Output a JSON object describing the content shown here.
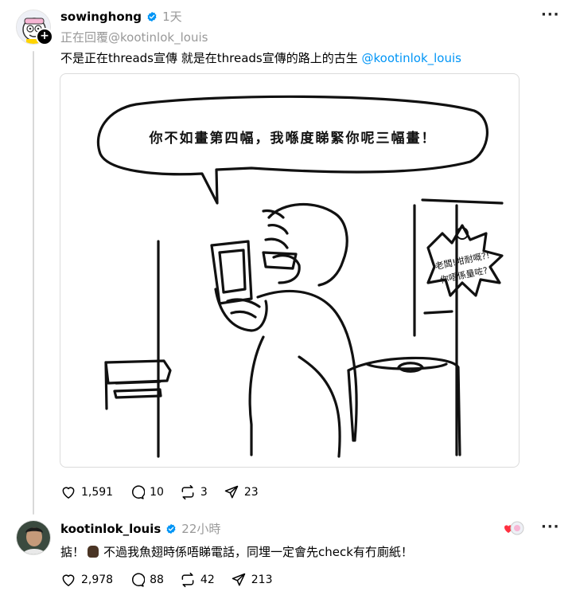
{
  "post": {
    "username": "sowinghong",
    "time": "1天",
    "replying_to": "正在回覆@kootinlok_louis",
    "text": "不是正在threads宣傳 就是在threads宣傳的路上的古生",
    "mention": "@kootinlok_louis",
    "comic": {
      "speech_bubble": "你不如畫第四幅，我喺度睇緊你呢三幅畫！",
      "sign_top": "老闆!咁耐嘅?!",
      "sign_bottom": "你唔係量咗?"
    },
    "stats": {
      "likes": "1,591",
      "replies": "10",
      "reposts": "3",
      "shares": "23"
    }
  },
  "reply": {
    "username": "kootinlok_louis",
    "time": "22小時",
    "text_before_emoji": "掂！",
    "text_after_emoji": "不過我魚翅時係唔睇電話，同埋一定會先check有冇廁紙！",
    "stats": {
      "likes": "2,978",
      "replies": "88",
      "reposts": "42",
      "shares": "213"
    }
  },
  "colors": {
    "accent_blue": "#0095f6",
    "verified_blue": "#0095f6",
    "meta_grey": "#999999",
    "heart_red": "#ff3040"
  },
  "icons": [
    "more-icon",
    "verified-icon",
    "heart-icon",
    "comment-icon",
    "repost-icon",
    "share-icon",
    "follow-plus-icon"
  ]
}
